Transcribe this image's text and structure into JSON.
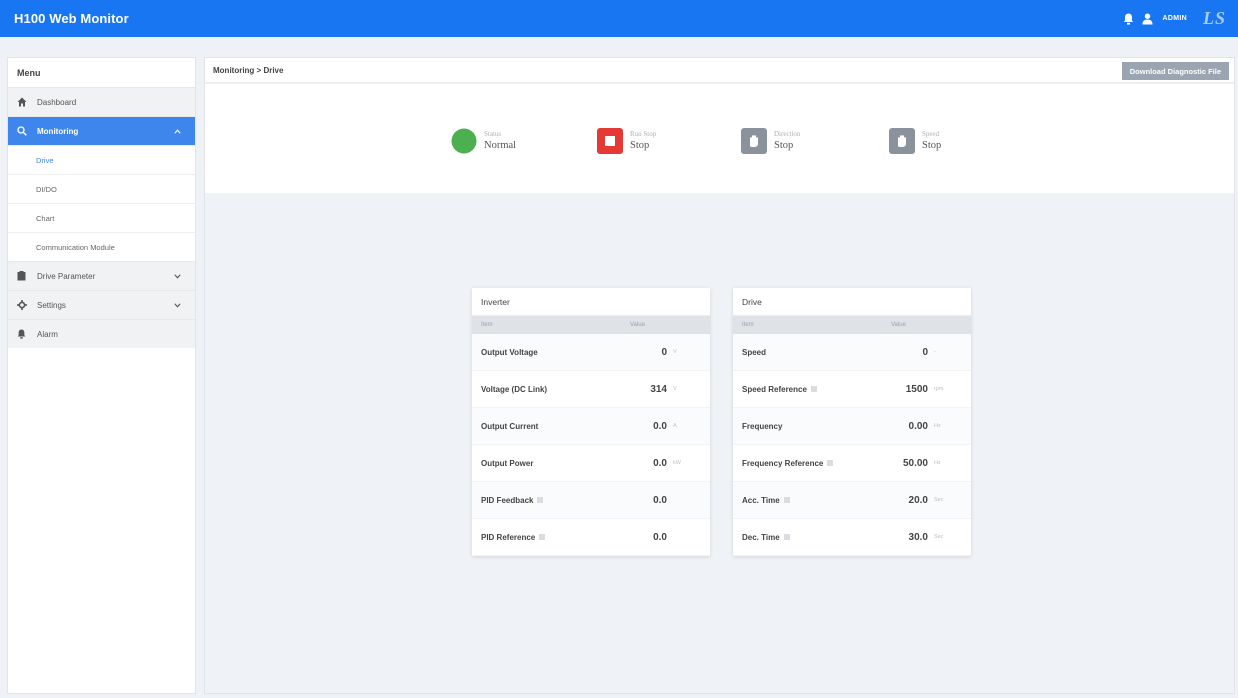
{
  "app": {
    "title": "H100 Web Monitor",
    "user": "ADMIN",
    "logo_text": "LS"
  },
  "menu": {
    "header": "Menu",
    "dashboard": "Dashboard",
    "monitoring": "Monitoring",
    "sub": [
      "Drive",
      "DI/DO",
      "Chart",
      "Communication Module"
    ],
    "drive_parameter": "Drive Parameter",
    "settings": "Settings",
    "alarm": "Alarm"
  },
  "breadcrumb": "Monitoring > Drive",
  "download_button": "Download Diagnostic File",
  "status": [
    {
      "label": "Status",
      "value": "Normal",
      "icon": "status-circle-icon",
      "color": "#4caf50"
    },
    {
      "label": "Run Stop",
      "value": "Stop",
      "icon": "stop-icon",
      "color": "#e53935"
    },
    {
      "label": "Direction",
      "value": "Stop",
      "icon": "hand-icon",
      "color": "#8a939c"
    },
    {
      "label": "Speed",
      "value": "Stop",
      "icon": "hand-icon",
      "color": "#8a939c"
    }
  ],
  "inverter": {
    "title": "Inverter",
    "col_item": "Item",
    "col_value": "Value",
    "rows": [
      {
        "label": "Output Voltage",
        "value": "0",
        "unit": "V"
      },
      {
        "label": "Voltage (DC Link)",
        "value": "314",
        "unit": "V"
      },
      {
        "label": "Output Current",
        "value": "0.0",
        "unit": "A"
      },
      {
        "label": "Output Power",
        "value": "0.0",
        "unit": "kW"
      },
      {
        "label": "PID Feedback",
        "value": "0.0",
        "unit": ""
      },
      {
        "label": "PID Reference",
        "value": "0.0",
        "unit": ""
      }
    ]
  },
  "drive": {
    "title": "Drive",
    "col_item": "Item",
    "col_value": "Value",
    "rows": [
      {
        "label": "Speed",
        "value": "0",
        "unit": "-"
      },
      {
        "label": "Speed Reference",
        "value": "1500",
        "unit": "rpm"
      },
      {
        "label": "Frequency",
        "value": "0.00",
        "unit": "Hz"
      },
      {
        "label": "Frequency Reference",
        "value": "50.00",
        "unit": "Hz"
      },
      {
        "label": "Acc. Time",
        "value": "20.0",
        "unit": "Sec"
      },
      {
        "label": "Dec. Time",
        "value": "30.0",
        "unit": "Sec"
      }
    ]
  },
  "colors": {
    "topbar": "#1976f2",
    "active_menu": "#3f86ec",
    "button": "#9aa5b1"
  }
}
